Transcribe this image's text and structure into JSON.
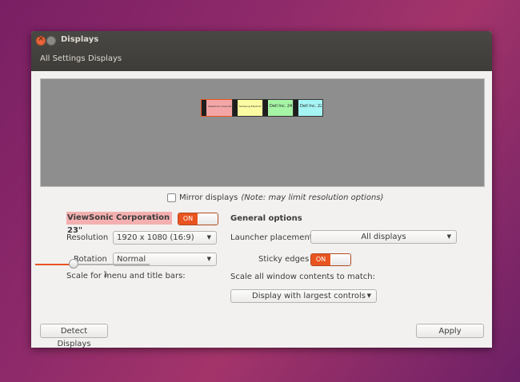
{
  "window": {
    "title": "Displays",
    "breadcrumbs": [
      "All Settings",
      "Displays"
    ]
  },
  "monitors": [
    {
      "label": "ViewSonic Corporation 23\"",
      "color": "#f4a6a6"
    },
    {
      "label": "Samsung Electronics Co Ltd 22\"",
      "color": "#fbfba2"
    },
    {
      "label": "Dell Inc. 24\"",
      "color": "#a6f4a6"
    },
    {
      "label": "Dell Inc. 22\"",
      "color": "#a6f4f4"
    }
  ],
  "mirror": {
    "label": "Mirror displays",
    "note": "(Note: may limit resolution options)",
    "checked": false
  },
  "selected_monitor": {
    "name": "ViewSonic Corporation 23\"",
    "toggle_label": "ON"
  },
  "fields": {
    "resolution_label": "Resolution",
    "resolution_value": "1920 x 1080 (16:9)",
    "rotation_label": "Rotation",
    "rotation_value": "Normal",
    "scale_label": "Scale for menu and title bars:",
    "scale_value": "1",
    "scale_level_fraction": 0.33
  },
  "general": {
    "heading": "General options",
    "launcher_label": "Launcher placement",
    "launcher_value": "All displays",
    "sticky_label": "Sticky edges",
    "sticky_toggle": "ON",
    "scale_all_label": "Scale all window contents to match:",
    "scale_all_value": "Display with largest controls"
  },
  "buttons": {
    "detect": "Detect Displays",
    "apply": "Apply"
  },
  "colors": {
    "accent": "#e95420",
    "titlebar": "#3d3c39"
  }
}
